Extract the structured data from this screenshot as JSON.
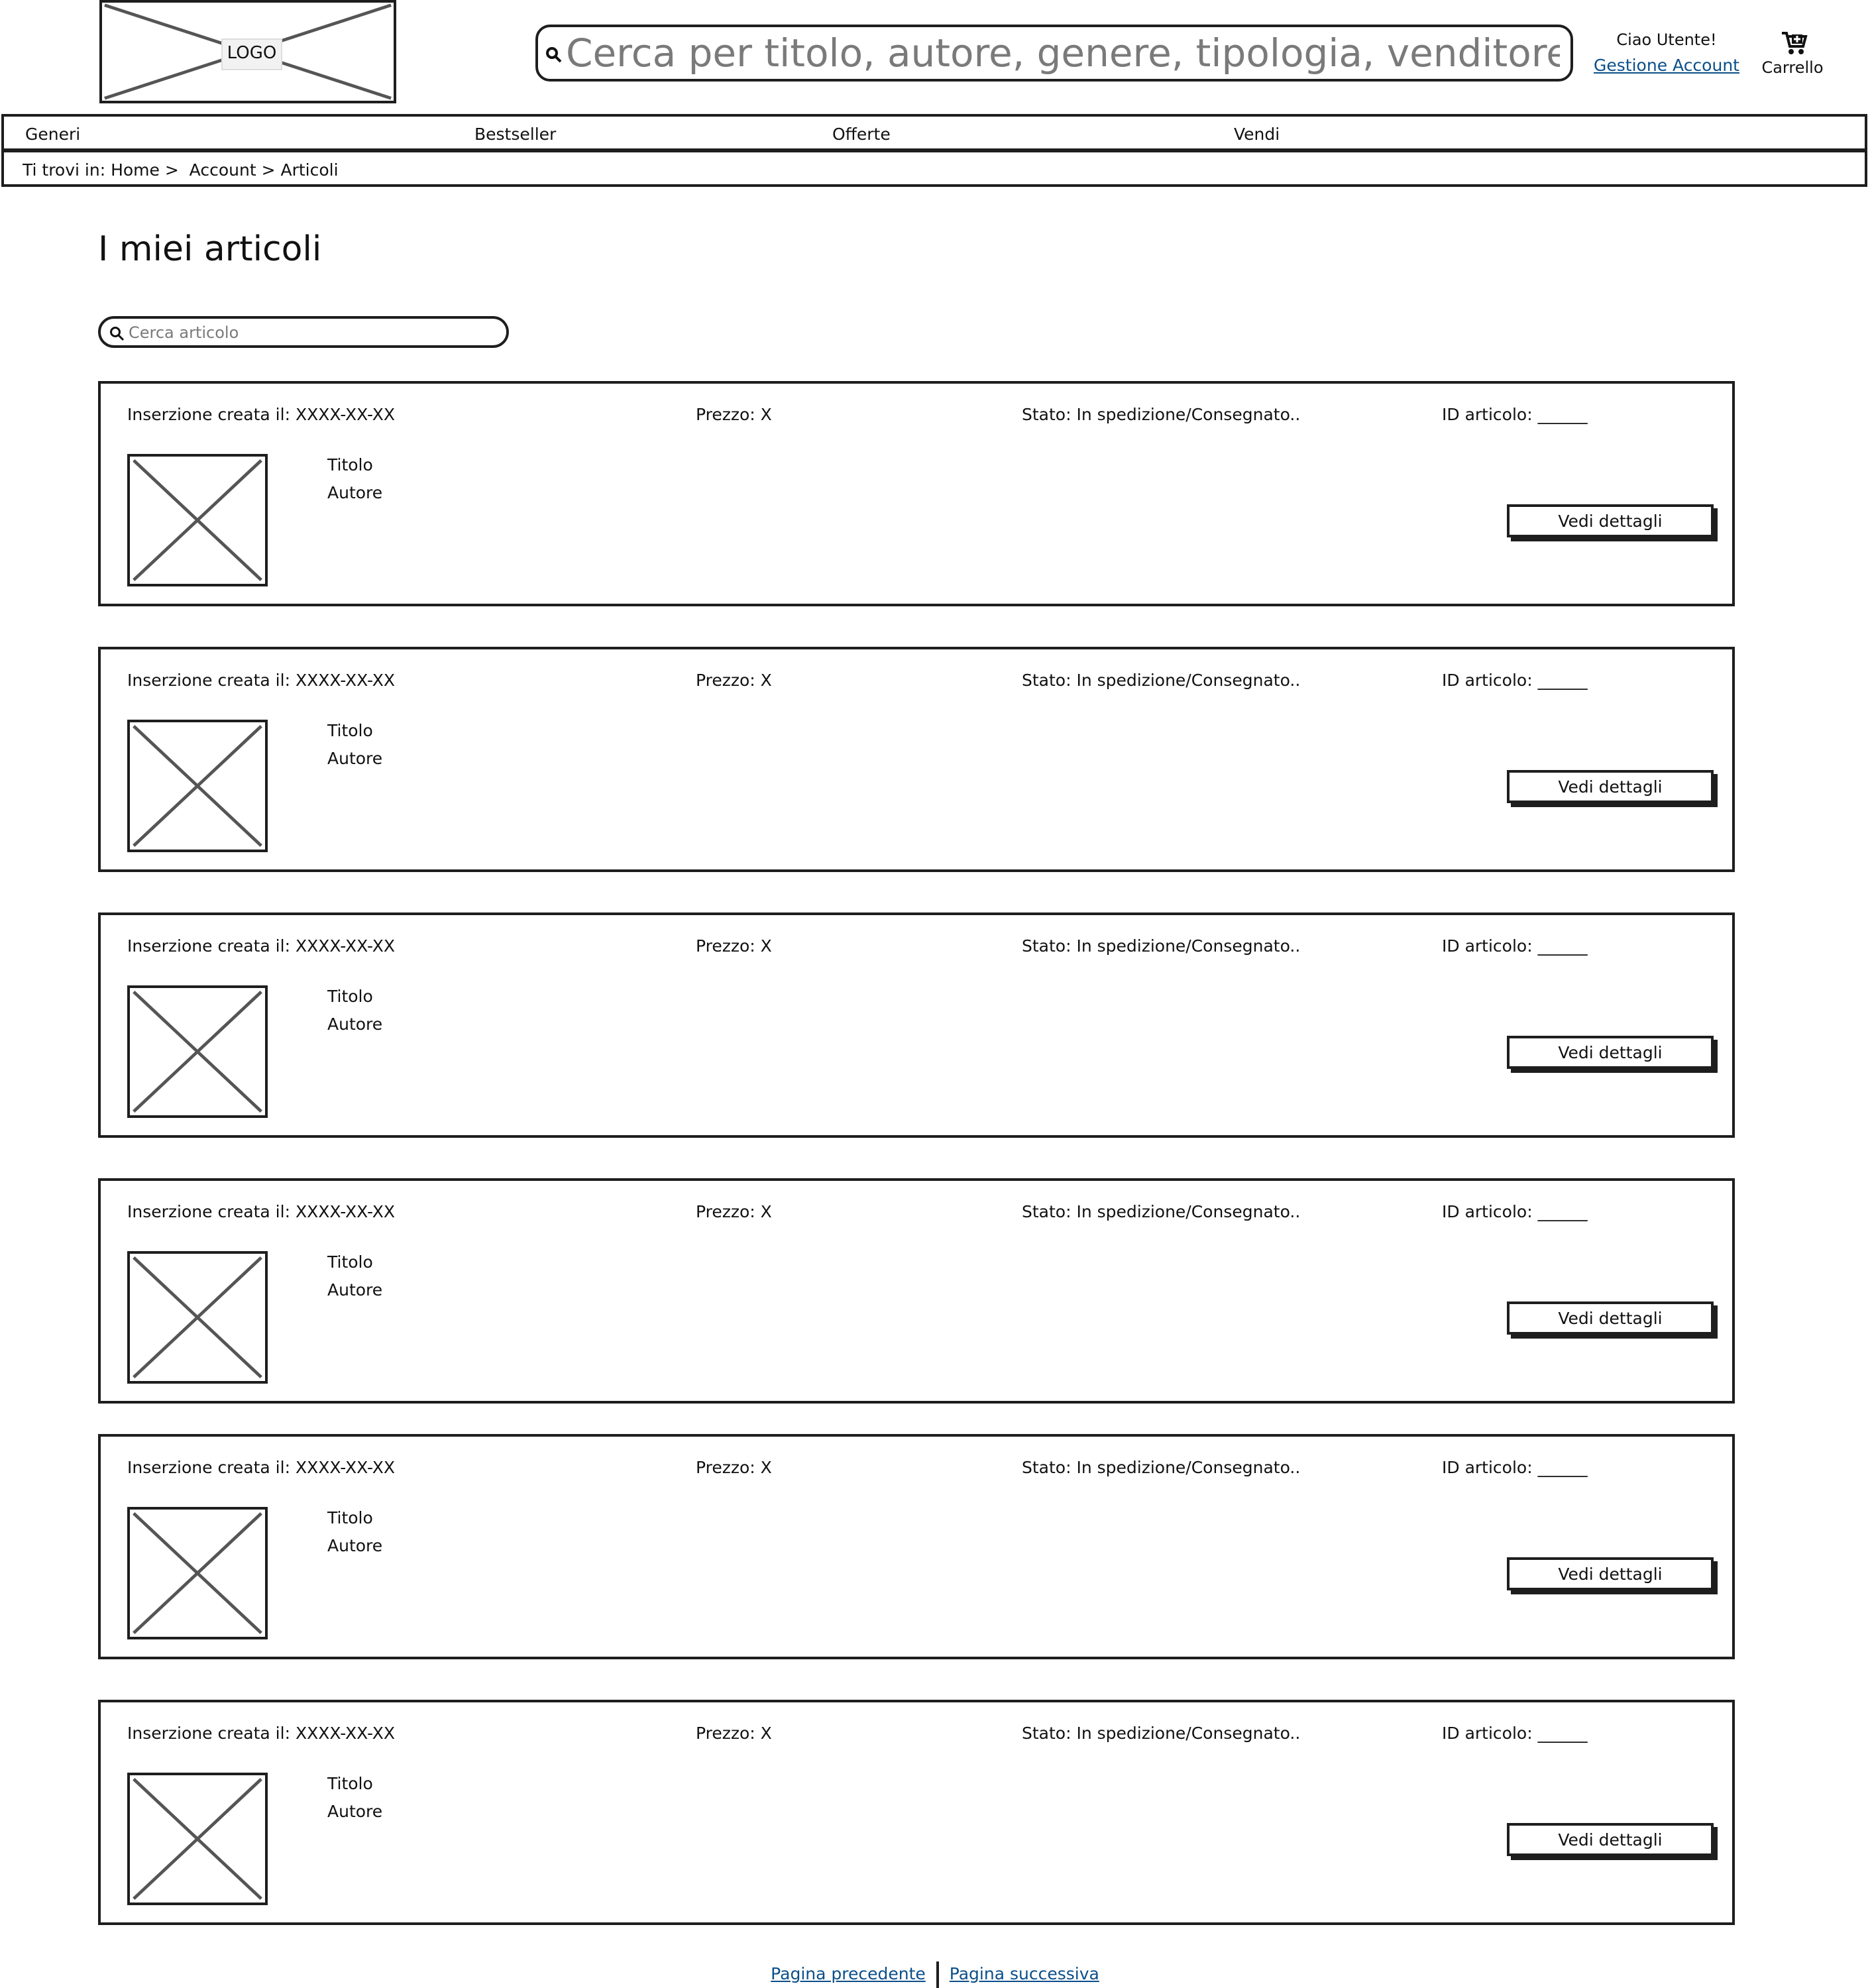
{
  "header": {
    "logo_label": "LOGO",
    "search_placeholder": "Cerca per titolo, autore, genere, tipologia, venditore...",
    "greeting": "Ciao Utente!",
    "account_link": "Gestione Account",
    "cart_label": "Carrello"
  },
  "nav": {
    "items": [
      {
        "label": "Generi"
      },
      {
        "label": "Bestseller"
      },
      {
        "label": "Offerte"
      },
      {
        "label": "Vendi"
      }
    ]
  },
  "breadcrumb": "Ti trovi in: Home >  Account > Articoli",
  "page": {
    "title": "I miei articoli",
    "search_placeholder": "Cerca articolo"
  },
  "articles": [
    {
      "created": "Inserzione creata il: XXXX-XX-XX",
      "price": "Prezzo: X",
      "status": "Stato: In spedizione/Consegnato..",
      "id": "ID articolo: ______",
      "title": "Titolo",
      "author": "Autore",
      "button": "Vedi dettagli"
    },
    {
      "created": "Inserzione creata il: XXXX-XX-XX",
      "price": "Prezzo: X",
      "status": "Stato: In spedizione/Consegnato..",
      "id": "ID articolo: ______",
      "title": "Titolo",
      "author": "Autore",
      "button": "Vedi dettagli"
    },
    {
      "created": "Inserzione creata il: XXXX-XX-XX",
      "price": "Prezzo: X",
      "status": "Stato: In spedizione/Consegnato..",
      "id": "ID articolo: ______",
      "title": "Titolo",
      "author": "Autore",
      "button": "Vedi dettagli"
    },
    {
      "created": "Inserzione creata il: XXXX-XX-XX",
      "price": "Prezzo: X",
      "status": "Stato: In spedizione/Consegnato..",
      "id": "ID articolo: ______",
      "title": "Titolo",
      "author": "Autore",
      "button": "Vedi dettagli"
    },
    {
      "created": "Inserzione creata il: XXXX-XX-XX",
      "price": "Prezzo: X",
      "status": "Stato: In spedizione/Consegnato..",
      "id": "ID articolo: ______",
      "title": "Titolo",
      "author": "Autore",
      "button": "Vedi dettagli"
    },
    {
      "created": "Inserzione creata il: XXXX-XX-XX",
      "price": "Prezzo: X",
      "status": "Stato: In spedizione/Consegnato..",
      "id": "ID articolo: ______",
      "title": "Titolo",
      "author": "Autore",
      "button": "Vedi dettagli"
    }
  ],
  "pagination": {
    "prev": "Pagina precedente",
    "next": "Pagina successiva"
  },
  "colors": {
    "line": "#1e1e1e",
    "link": "#0b4f8a",
    "placeholder": "#7a7a7a"
  },
  "icons": [
    "search-icon",
    "cart-icon",
    "image-placeholder-icon"
  ]
}
